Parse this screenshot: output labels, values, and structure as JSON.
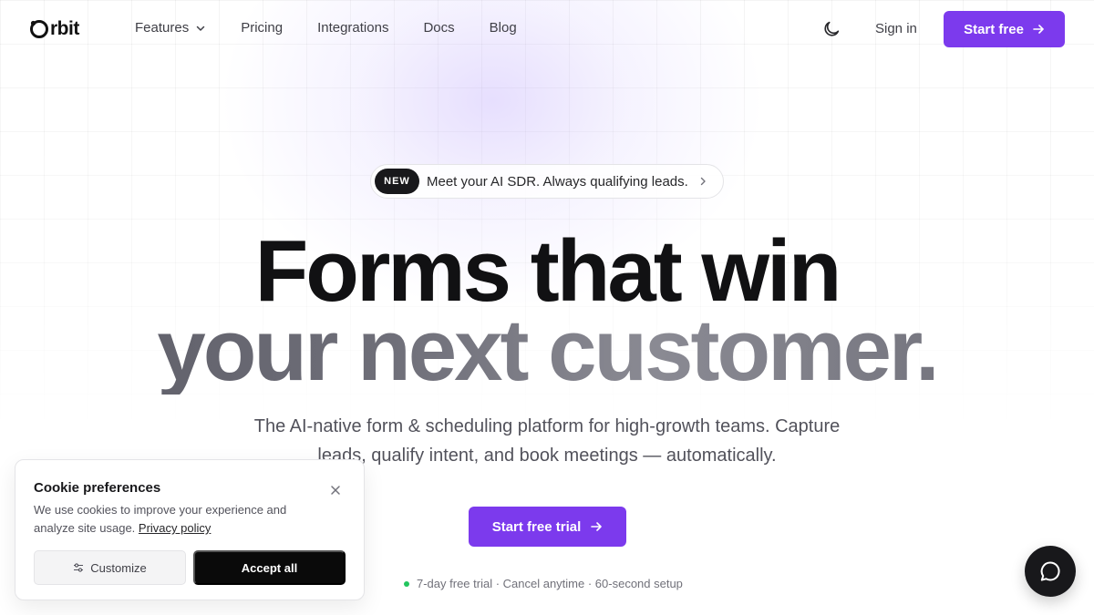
{
  "brand": {
    "name": "rbit",
    "logo_icon": "orbit-o-icon",
    "accent_color": "#7c3aed"
  },
  "nav": {
    "links": [
      {
        "label": "Features",
        "has_dropdown": true
      },
      {
        "label": "Pricing"
      },
      {
        "label": "Integrations"
      },
      {
        "label": "Docs"
      },
      {
        "label": "Blog"
      }
    ],
    "theme_toggle_icon": "moon-icon",
    "sign_in": "Sign in",
    "start_free": "Start free"
  },
  "announcement": {
    "badge": "NEW",
    "text": "Meet your AI SDR. Always qualifying leads."
  },
  "hero": {
    "headline_line1": "Forms that win",
    "headline_line2": "your next customer.",
    "subheadline": "The AI-native form & scheduling platform for high-growth teams. Capture leads, qualify intent, and book meetings — automatically.",
    "cta": "Start free trial",
    "note": "7-day free trial · Cancel anytime · 60-second setup"
  },
  "cookie": {
    "title": "Cookie preferences",
    "body": "We use cookies to improve your experience and analyze site usage.",
    "link": "Privacy policy",
    "customize": "Customize",
    "accept": "Accept all"
  },
  "chat": {
    "icon": "chat-bubble-icon"
  }
}
